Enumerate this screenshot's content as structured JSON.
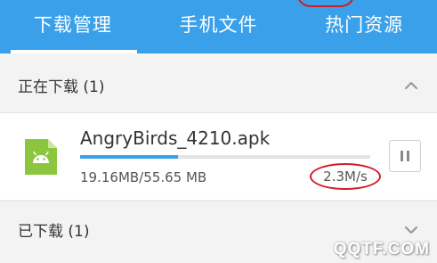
{
  "tabs": [
    {
      "label": "下载管理",
      "active": true
    },
    {
      "label": "手机文件",
      "active": false
    },
    {
      "label": "热门资源",
      "active": false
    }
  ],
  "downloading_section": {
    "label": "正在下载 (1)",
    "expanded": true
  },
  "download_item": {
    "file_name": "AngryBirds_4210.apk",
    "progress_fraction": 0.338,
    "size_text": "19.16MB/55.65 MB",
    "speed_text": "2.3M/s",
    "icon": "android-apk-icon",
    "action_icon": "pause-icon"
  },
  "downloaded_section": {
    "label": "已下载 (1)",
    "expanded": false
  },
  "watermark": "QQTF.COM",
  "colors": {
    "accent": "#3aa0ea",
    "annotation_red": "#d01c2a",
    "android_green": "#8cc63f"
  }
}
